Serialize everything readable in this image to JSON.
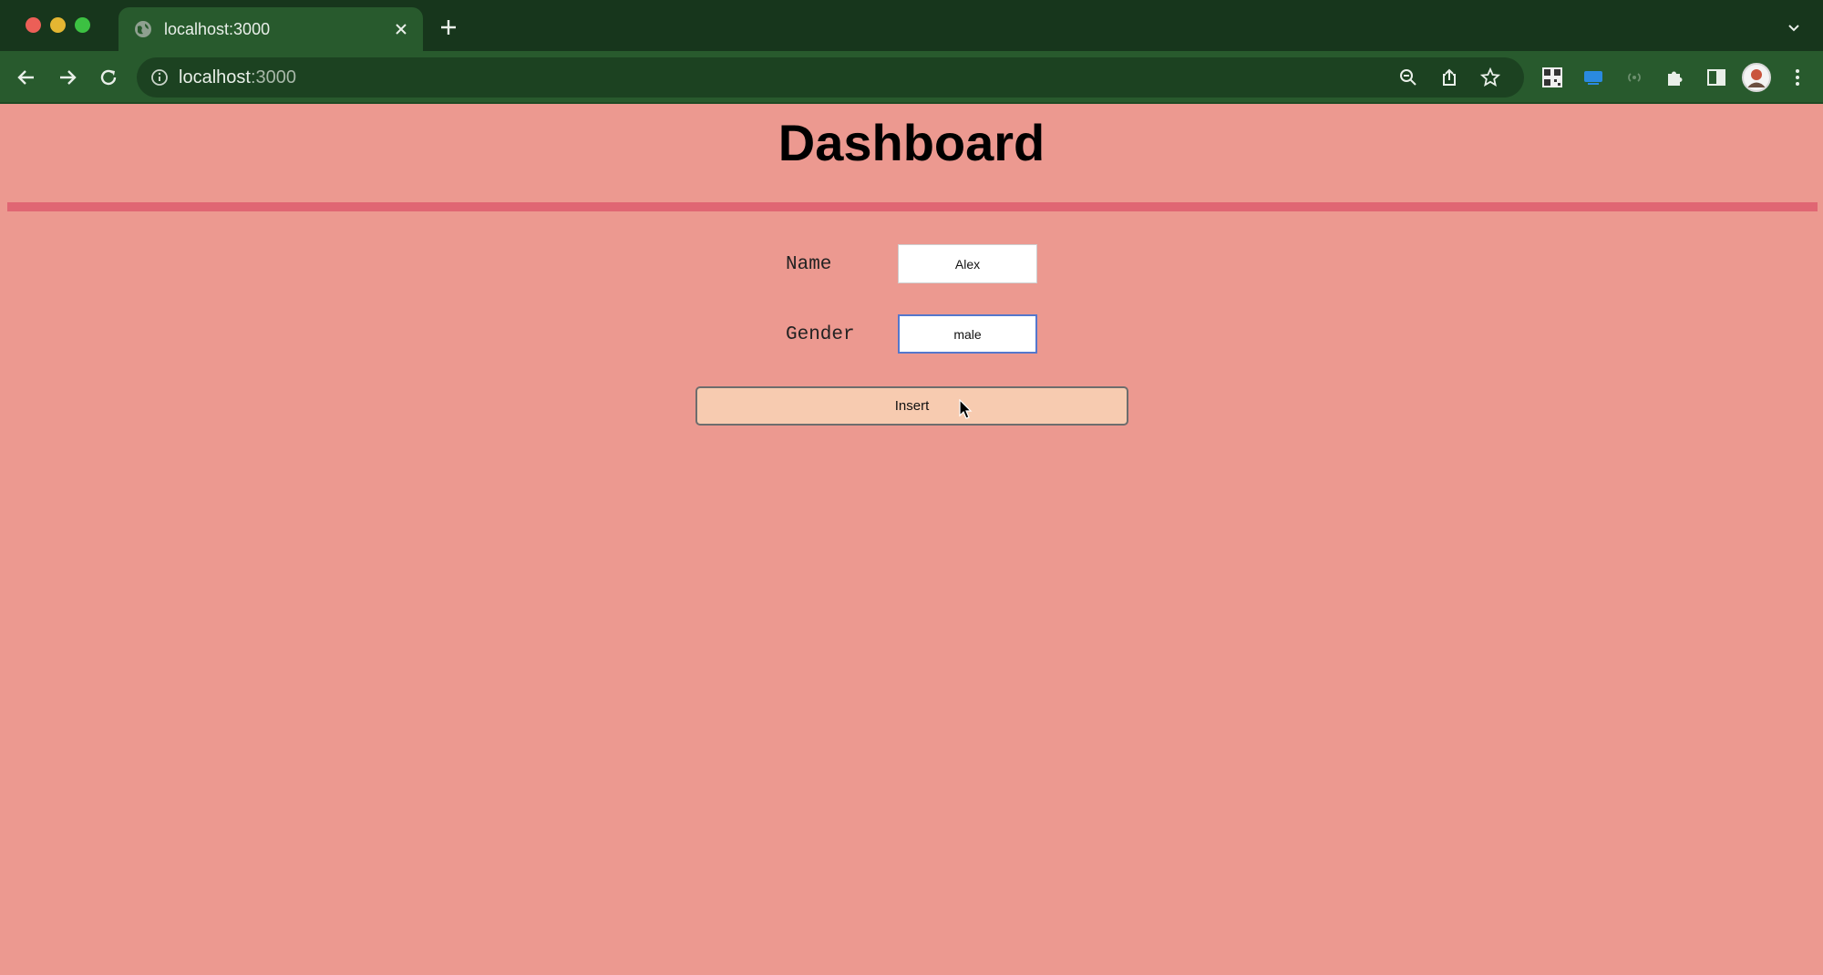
{
  "browser": {
    "tab": {
      "title": "localhost:3000",
      "favicon_icon": "globe-icon",
      "close_icon": "close-icon"
    },
    "new_tab_icon": "plus-icon",
    "tab_menu_icon": "chevron-down-icon",
    "toolbar": {
      "back_icon": "arrow-left-icon",
      "forward_icon": "arrow-right-icon",
      "reload_icon": "reload-icon",
      "url_host": "localhost",
      "url_port": ":3000",
      "omnibox_icons": [
        "zoom-icon",
        "share-icon",
        "bookmark-star-icon"
      ],
      "extension_icons": [
        "qr-code-icon",
        "screen-icon",
        "broadcast-icon",
        "puzzle-icon",
        "side-panel-icon"
      ],
      "profile_icon": "avatar",
      "menu_icon": "kebab-menu-icon"
    },
    "colors": {
      "tabstrip": "#17361c",
      "toolbar": "#285a2d",
      "omnibox": "#1c4221"
    }
  },
  "page": {
    "title": "Dashboard",
    "background": "#ec9990",
    "rule_color": "#e06673",
    "form": {
      "name_label": "Name",
      "name_value": "Alex",
      "gender_label": "Gender",
      "gender_value": "male",
      "insert_label": "Insert"
    }
  }
}
